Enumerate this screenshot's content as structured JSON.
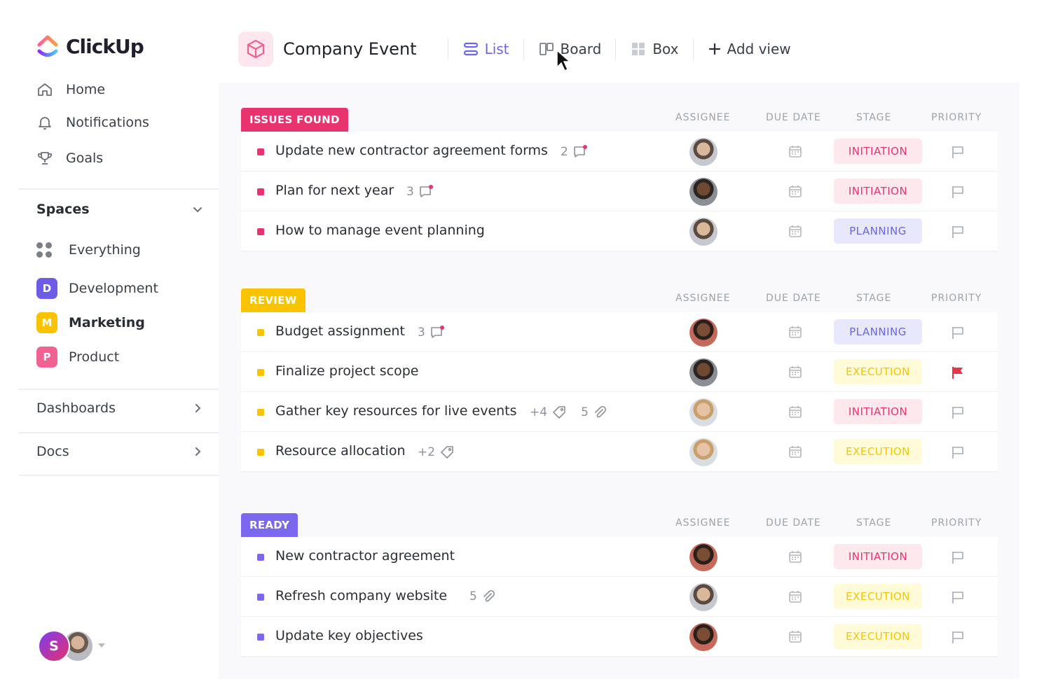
{
  "app": {
    "name": "ClickUp"
  },
  "colors": {
    "brand_pink": "#e8336e",
    "brand_purple": "#6c66e8",
    "review_yellow": "#f9c300",
    "ready_purple": "#7b68ee"
  },
  "sidebar": {
    "nav": [
      {
        "label": "Home",
        "icon": "home-icon"
      },
      {
        "label": "Notifications",
        "icon": "bell-icon"
      },
      {
        "label": "Goals",
        "icon": "trophy-icon"
      }
    ],
    "spaces_label": "Spaces",
    "spaces": [
      {
        "label": "Everything",
        "badge": "",
        "color": ""
      },
      {
        "label": "Development",
        "badge": "D",
        "color": "#6c5ce7"
      },
      {
        "label": "Marketing",
        "badge": "M",
        "color": "#f9c300"
      },
      {
        "label": "Product",
        "badge": "P",
        "color": "#f06292"
      }
    ],
    "dashboards_label": "Dashboards",
    "docs_label": "Docs",
    "user_initial": "S"
  },
  "header": {
    "project_title": "Company Event",
    "views": [
      {
        "label": "List",
        "icon": "list-icon",
        "active": true
      },
      {
        "label": "Board",
        "icon": "board-icon",
        "active": false
      },
      {
        "label": "Box",
        "icon": "box-icon",
        "active": false
      },
      {
        "label": "Add view",
        "icon": "plus-icon",
        "active": false
      }
    ]
  },
  "columns": {
    "assignee": "ASSIGNEE",
    "due_date": "DUE DATE",
    "stage": "STAGE",
    "priority": "PRIORITY"
  },
  "groups": [
    {
      "label": "ISSUES FOUND",
      "color": "#e8336e",
      "tasks": [
        {
          "title": "Update new contractor agreement forms",
          "comments": "2",
          "tags": "",
          "attachments": "",
          "stage": "INITIATION",
          "stage_key": "initiation",
          "priority_flag": "empty"
        },
        {
          "title": "Plan for next year",
          "comments": "3",
          "tags": "",
          "attachments": "",
          "stage": "INITIATION",
          "stage_key": "initiation",
          "priority_flag": "empty"
        },
        {
          "title": "How to manage event planning",
          "comments": "",
          "tags": "",
          "attachments": "",
          "stage": "PLANNING",
          "stage_key": "planning",
          "priority_flag": "empty"
        }
      ]
    },
    {
      "label": "REVIEW",
      "color": "#f9c300",
      "tasks": [
        {
          "title": "Budget assignment",
          "comments": "3",
          "tags": "",
          "attachments": "",
          "stage": "PLANNING",
          "stage_key": "planning",
          "priority_flag": "empty"
        },
        {
          "title": "Finalize project scope",
          "comments": "",
          "tags": "",
          "attachments": "",
          "stage": "EXECUTION",
          "stage_key": "execution",
          "priority_flag": "urgent"
        },
        {
          "title": "Gather key resources for live events",
          "comments": "",
          "tags": "+4",
          "attachments": "5",
          "stage": "INITIATION",
          "stage_key": "initiation",
          "priority_flag": "empty"
        },
        {
          "title": "Resource allocation",
          "comments": "",
          "tags": "+2",
          "attachments": "",
          "stage": "EXECUTION",
          "stage_key": "execution",
          "priority_flag": "empty"
        }
      ]
    },
    {
      "label": "READY",
      "color": "#7b68ee",
      "tasks": [
        {
          "title": "New contractor agreement",
          "comments": "",
          "tags": "",
          "attachments": "",
          "stage": "INITIATION",
          "stage_key": "initiation",
          "priority_flag": "empty"
        },
        {
          "title": "Refresh company website",
          "comments": "",
          "tags": "",
          "attachments": "5",
          "stage": "EXECUTION",
          "stage_key": "execution",
          "priority_flag": "empty"
        },
        {
          "title": "Update key objectives",
          "comments": "",
          "tags": "",
          "attachments": "",
          "stage": "EXECUTION",
          "stage_key": "execution",
          "priority_flag": "empty"
        }
      ]
    }
  ]
}
